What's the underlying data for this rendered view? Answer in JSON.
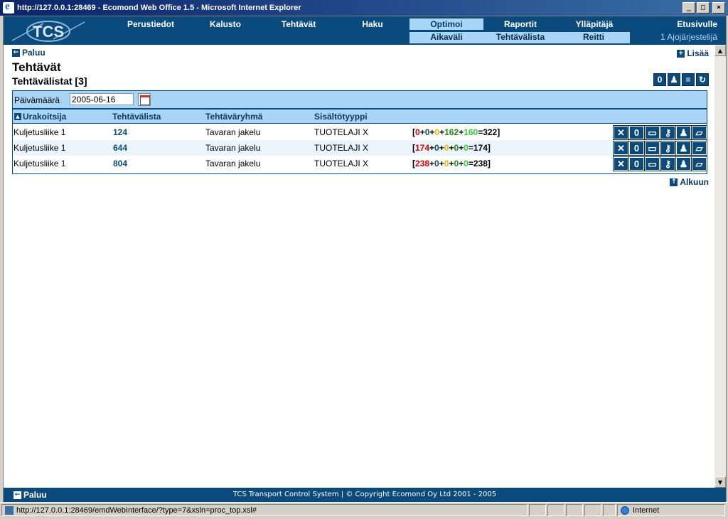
{
  "window": {
    "title": "http://127.0.0.1:28469 - Ecomond Web Office 1.5 - Microsoft Internet Explorer"
  },
  "nav": {
    "items": [
      "Perustiedot",
      "Kalusto",
      "Tehtävät",
      "Haku",
      "Optimoi",
      "Raportit",
      "Ylläpitäjä",
      "Etusivulle"
    ],
    "sub": [
      "Aikaväli",
      "Tehtävälista",
      "Reitti"
    ],
    "user": "1 Ajojärjestelijä",
    "logo": "TCS"
  },
  "page": {
    "back": "Paluu",
    "add": "Lisää",
    "title": "Tehtävät",
    "subtitle": "Tehtävälistat [3]",
    "top": "Alkuun",
    "toolbar_icons": [
      "zero-icon",
      "worker-icon",
      "document-icon",
      "refresh-icon"
    ]
  },
  "filter": {
    "date_label": "Päivämäärä",
    "date_value": "2005-06-16"
  },
  "table": {
    "headers": [
      "Urakoitsija",
      "Tehtävälista",
      "Tehtäväryhmä",
      "Sisältötyyppi"
    ],
    "rows": [
      {
        "contractor": "Kuljetusliike 1",
        "list": "124",
        "group": "Tavaran jakelu",
        "type": "TUOTELAJI X",
        "sum": [
          "0",
          "0",
          "0",
          "162",
          "160",
          "322"
        ]
      },
      {
        "contractor": "Kuljetusliike 1",
        "list": "644",
        "group": "Tavaran jakelu",
        "type": "TUOTELAJI X",
        "sum": [
          "174",
          "0",
          "0",
          "0",
          "0",
          "174"
        ]
      },
      {
        "contractor": "Kuljetusliike 1",
        "list": "804",
        "group": "Tavaran jakelu",
        "type": "TUOTELAJI X",
        "sum": [
          "238",
          "0",
          "0",
          "0",
          "0",
          "238"
        ]
      }
    ],
    "row_actions": [
      "delete-icon",
      "zero-icon",
      "truck-icon",
      "key-icon",
      "worker-icon",
      "folder-icon"
    ]
  },
  "footer": {
    "back": "Paluu",
    "text": "TCS Transport Control System | © Copyright Ecomond Oy Ltd 2001 - 2005"
  },
  "status": {
    "url": "http://127.0.0.1:28469/emdWebInterface/?type=7&xsln=proc_top.xsl#",
    "zone": "Internet"
  },
  "colors": {
    "navy": "#0a4a7c",
    "light": "#a8d4f5",
    "red": "#d40000",
    "yellow": "#f0b400",
    "green": "#1a8a1a",
    "lightgreen": "#33cc33"
  }
}
